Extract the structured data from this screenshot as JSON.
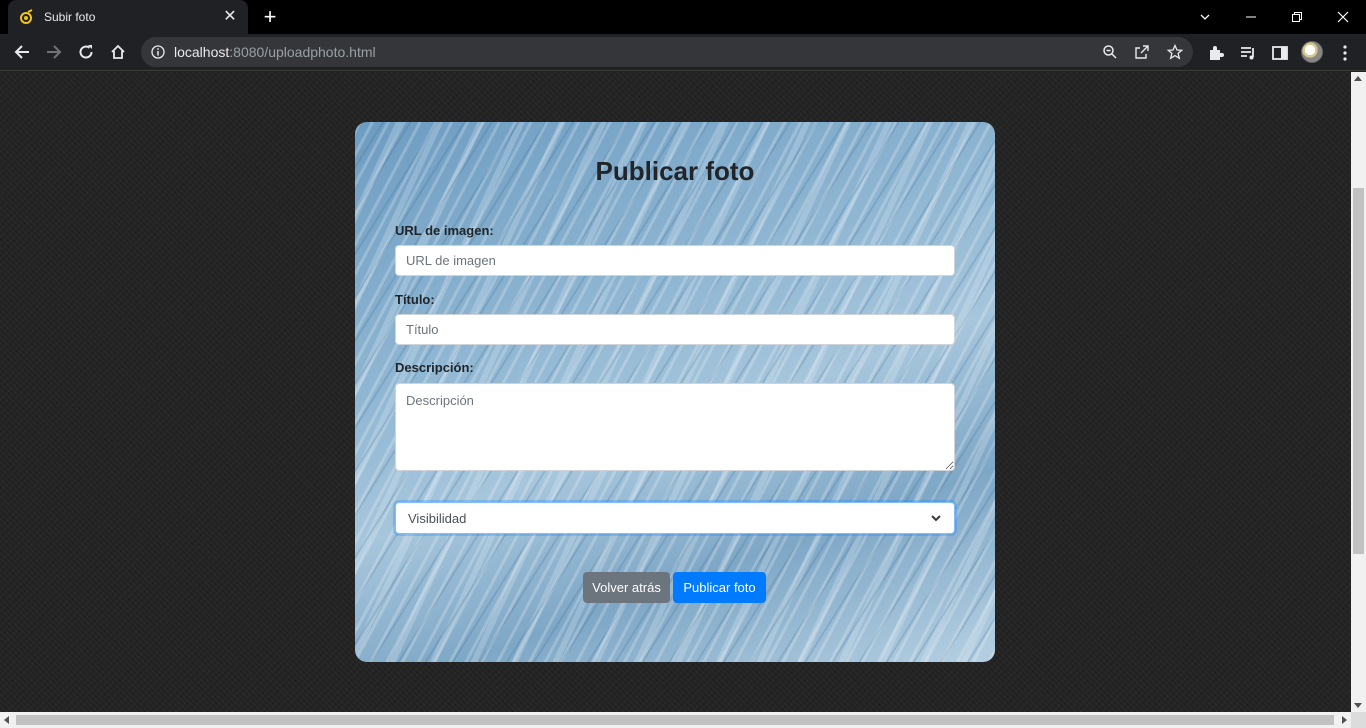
{
  "browser": {
    "tab_title": "Subir foto",
    "url_host": "localhost",
    "url_rest": ":8080/uploadphoto.html"
  },
  "page": {
    "heading": "Publicar foto",
    "fields": {
      "image_url": {
        "label": "URL de imagen:",
        "placeholder": "URL de imagen",
        "value": ""
      },
      "title": {
        "label": "Título:",
        "placeholder": "Título",
        "value": ""
      },
      "description": {
        "label": "Descripción:",
        "placeholder": "Descripción",
        "value": ""
      }
    },
    "visibility": {
      "selected": "Visibilidad"
    },
    "buttons": {
      "back": "Volver atrás",
      "publish": "Publicar foto"
    }
  },
  "colors": {
    "primary": "#007bff",
    "secondary": "#6c757d",
    "text": "#212529"
  }
}
